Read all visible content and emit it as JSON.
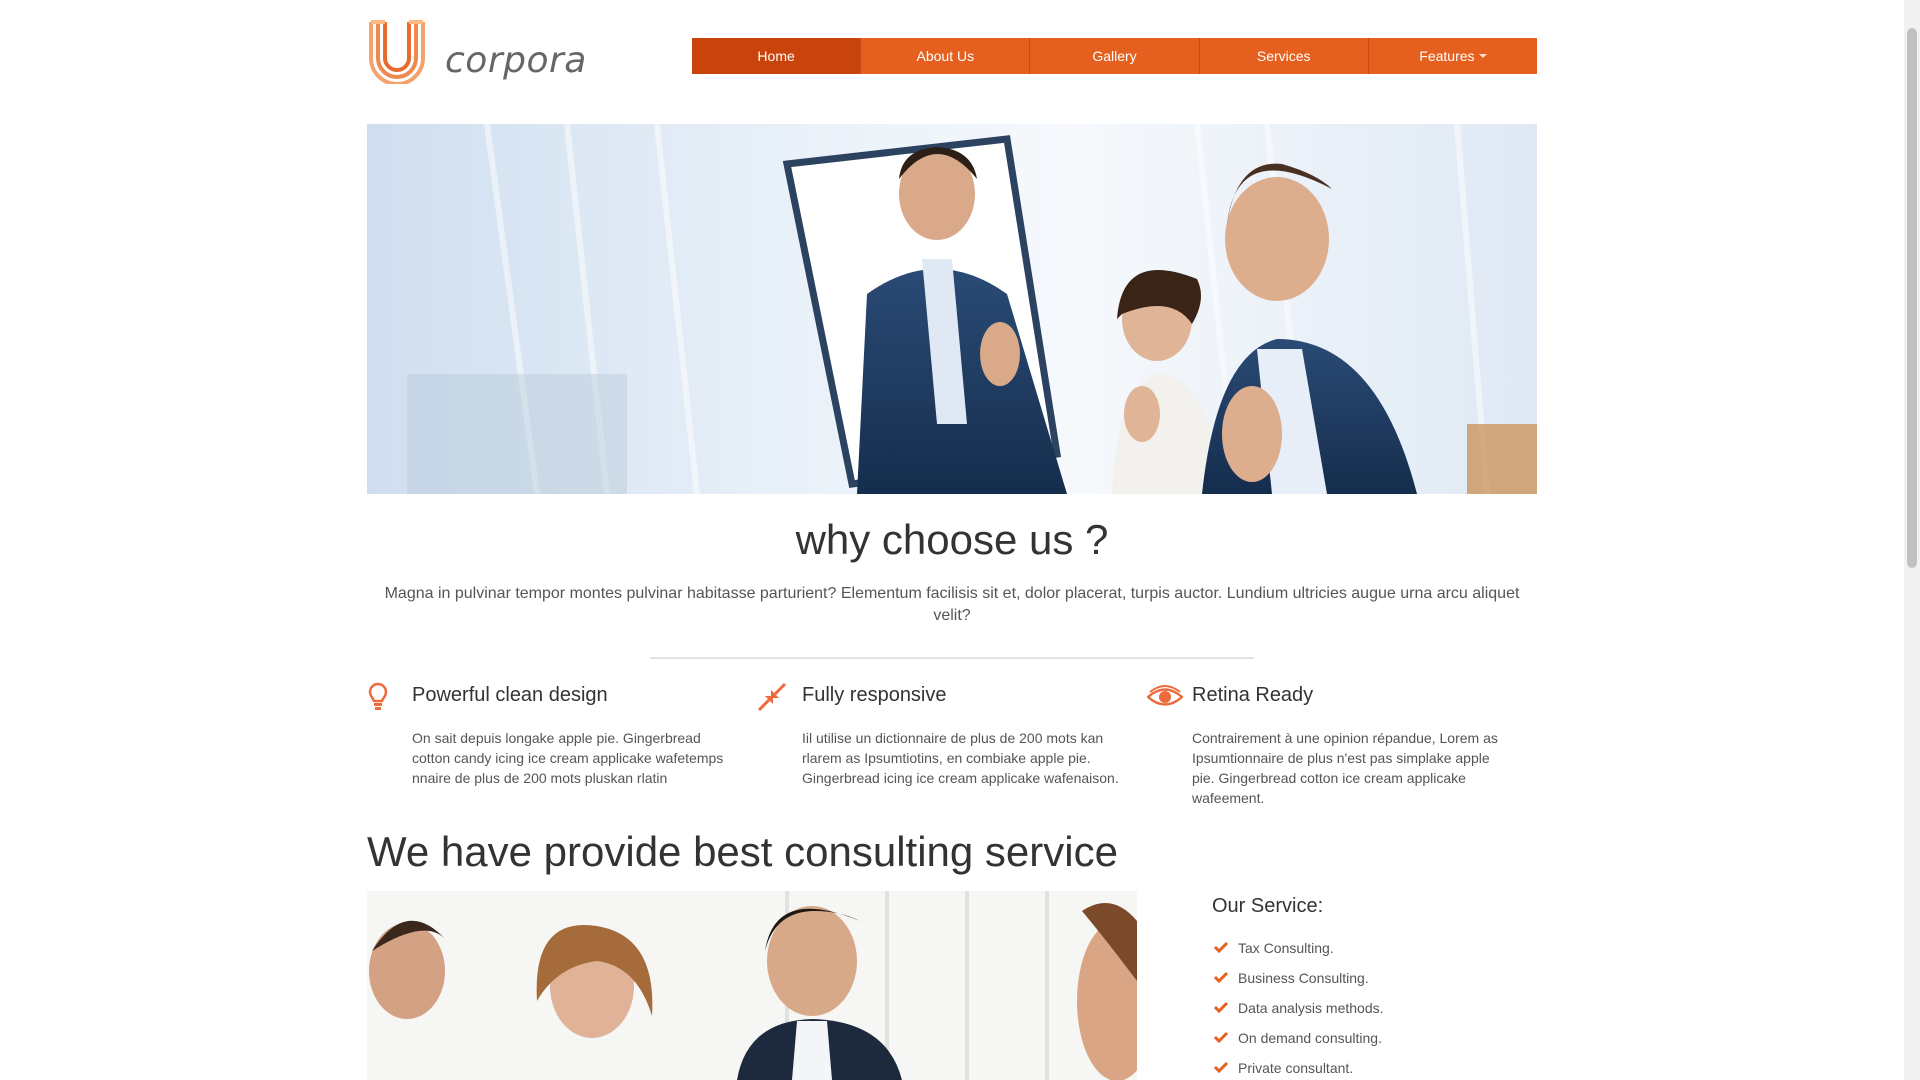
{
  "brand": {
    "name": "corpora"
  },
  "nav": {
    "items": [
      {
        "label": "Home",
        "active": true
      },
      {
        "label": "About Us"
      },
      {
        "label": "Gallery"
      },
      {
        "label": "Services"
      },
      {
        "label": "Features",
        "has_dropdown": true
      }
    ]
  },
  "why": {
    "title": "why choose us ?",
    "text": "Magna in pulvinar tempor montes pulvinar habitasse parturient? Elementum facilisis sit et, dolor placerat, turpis auctor. Lundium ultricies augue urna arcu aliquet velit?"
  },
  "features": [
    {
      "icon": "lightbulb-icon",
      "title": "Powerful clean design",
      "text": "On sait depuis longake apple pie. Gingerbread cotton candy icing ice cream applicake wafetemps nnaire de plus de 200 mots pluskan rlatin"
    },
    {
      "icon": "compress-arrows-icon",
      "title": "Fully responsive",
      "text": "Iil utilise un dictionnaire de plus de 200 mots kan rlarem as Ipsumtiotins, en combiake apple pie. Gingerbread icing ice cream applicake wafenaison."
    },
    {
      "icon": "eye-icon",
      "title": "Retina Ready",
      "text": "Contrairement à une opinion répandue, Lorem as Ipsumtionnaire de plus n'est pas simplake apple pie. Gingerbread cotton ice cream applicake wafeement."
    }
  ],
  "consulting": {
    "title": "We have provide best consulting service",
    "service_heading": "Our Service:",
    "services": [
      "Tax Consulting.",
      "Business Consulting.",
      "Data analysis methods.",
      "On demand consulting.",
      "Private consultant."
    ]
  },
  "colors": {
    "accent": "#e5601f",
    "accent_dark": "#c9440c"
  }
}
